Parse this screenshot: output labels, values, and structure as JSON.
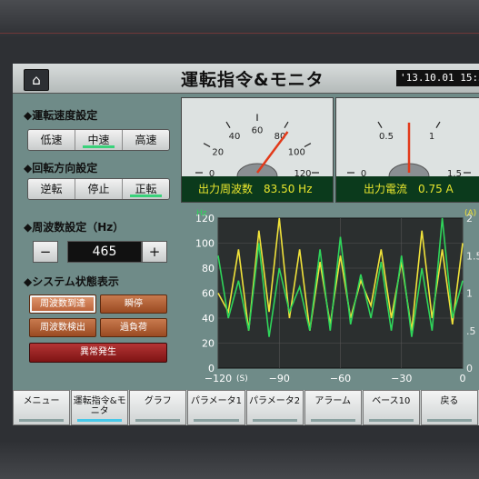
{
  "header": {
    "title": "運転指令&モニタ",
    "datetime": "'13.10.01 15:5"
  },
  "speed": {
    "label": "◆運転速度設定",
    "buttons": [
      "低速",
      "中速",
      "高速"
    ],
    "selected": "中速"
  },
  "direction": {
    "label": "◆回転方向設定",
    "buttons": [
      "逆転",
      "停止",
      "正転"
    ],
    "selected": "正転"
  },
  "frequency": {
    "label": "◆周波数設定（Hz）",
    "value": "465",
    "minus": "−",
    "plus": "+"
  },
  "system": {
    "label": "◆システム状態表示",
    "status": [
      "周波数到達",
      "瞬停",
      "周波数検出",
      "過負荷"
    ],
    "alarm": "異常発生"
  },
  "meters": [
    {
      "ticks": [
        "0",
        "20",
        "40",
        "60",
        "80",
        "100",
        "120"
      ],
      "readout": "出力周波数　83.50 Hz",
      "value": 83.5,
      "max": 120
    },
    {
      "ticks": [
        "0",
        "0.5",
        "1",
        "1.5"
      ],
      "readout": "出力電流　0.75 A",
      "value": 0.75,
      "max": 1.5
    }
  ],
  "chart_data": {
    "type": "line",
    "left_unit": "Hz",
    "right_unit": "(A)",
    "ylim_left": [
      0,
      120
    ],
    "yticks_left": [
      "0",
      "20",
      "40",
      "60",
      "80",
      "100",
      "120"
    ],
    "ylim_right": [
      0,
      2
    ],
    "yticks_right": [
      "0",
      ".5",
      "1",
      "1.5",
      "2"
    ],
    "xlim": [
      -120,
      0
    ],
    "xticks": [
      "−120",
      "−90",
      "−60",
      "−30",
      "0"
    ],
    "xunit": "(S)",
    "x": [
      -120,
      -115,
      -110,
      -105,
      -100,
      -95,
      -90,
      -85,
      -80,
      -75,
      -70,
      -65,
      -60,
      -55,
      -50,
      -45,
      -40,
      -35,
      -30,
      -25,
      -20,
      -15,
      -10,
      -5,
      0
    ],
    "series": [
      {
        "color": "#f0e23a",
        "values": [
          60,
          45,
          95,
          30,
          110,
          45,
          120,
          40,
          95,
          30,
          85,
          35,
          90,
          40,
          70,
          50,
          95,
          40,
          85,
          30,
          110,
          40,
          95,
          35,
          100
        ]
      },
      {
        "color": "#2fd45a",
        "values": [
          90,
          40,
          70,
          30,
          100,
          25,
          80,
          45,
          65,
          30,
          95,
          30,
          105,
          35,
          75,
          40,
          85,
          30,
          90,
          25,
          80,
          30,
          120,
          40,
          70
        ]
      }
    ]
  },
  "tabs": [
    "メニュー",
    "運転指令&モニタ",
    "グラフ",
    "パラメータ1",
    "パラメータ2",
    "アラーム",
    "ベース10",
    "戻る"
  ],
  "active_tab": 1
}
